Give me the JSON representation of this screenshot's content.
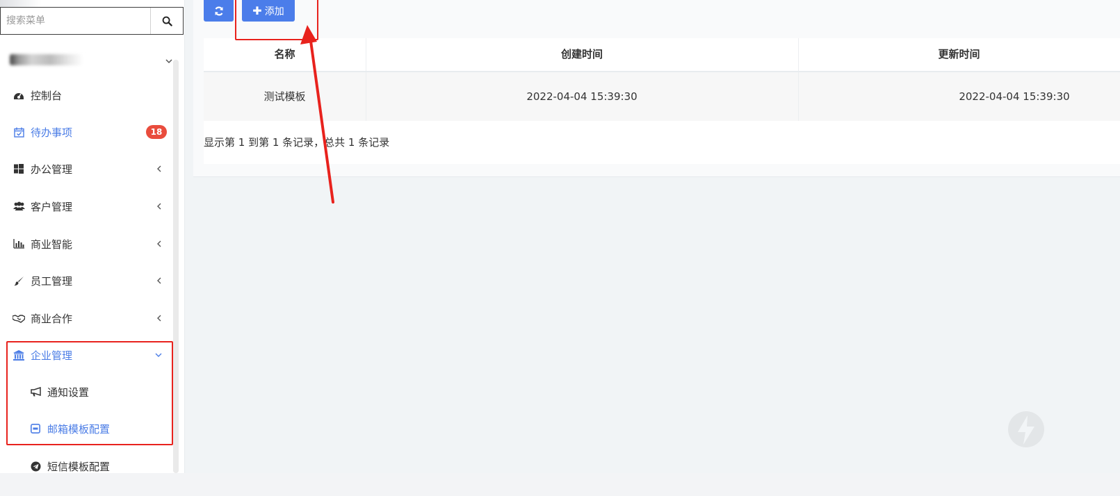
{
  "search": {
    "placeholder": "搜索菜单"
  },
  "sidebar": {
    "items": [
      {
        "label": "控制台",
        "icon": "dashboard-icon"
      },
      {
        "label": "待办事项",
        "icon": "calendar-check-icon",
        "badge": "18",
        "active": true
      },
      {
        "label": "办公管理",
        "icon": "windows-icon"
      },
      {
        "label": "客户管理",
        "icon": "users-icon"
      },
      {
        "label": "商业智能",
        "icon": "bar-chart-icon"
      },
      {
        "label": "员工管理",
        "icon": "paint-brush-icon"
      },
      {
        "label": "商业合作",
        "icon": "handshake-icon"
      },
      {
        "label": "企业管理",
        "icon": "bank-icon",
        "active": true
      }
    ],
    "sub_items": [
      {
        "label": "通知设置",
        "icon": "bullhorn-icon"
      },
      {
        "label": "邮箱模板配置",
        "icon": "envelope-square-icon",
        "active": true
      },
      {
        "label": "短信模板配置",
        "icon": "telegram-icon"
      }
    ]
  },
  "toolbar": {
    "add_label": "添加",
    "add_icon": "plus-icon",
    "refresh_icon": "refresh-icon"
  },
  "table": {
    "headers": [
      "名称",
      "创建时间",
      "更新时间"
    ],
    "rows": [
      [
        "测试模板",
        "2022-04-04 15:39:30",
        "2022-04-04 15:39:30"
      ]
    ]
  },
  "pagination": {
    "info": "显示第 1 到第 1 条记录，总共 1 条记录"
  },
  "colors": {
    "primary": "#4b7dea",
    "active_text": "#4a7ce6",
    "badge": "#e94c3d",
    "annotation": "#e8221d"
  }
}
